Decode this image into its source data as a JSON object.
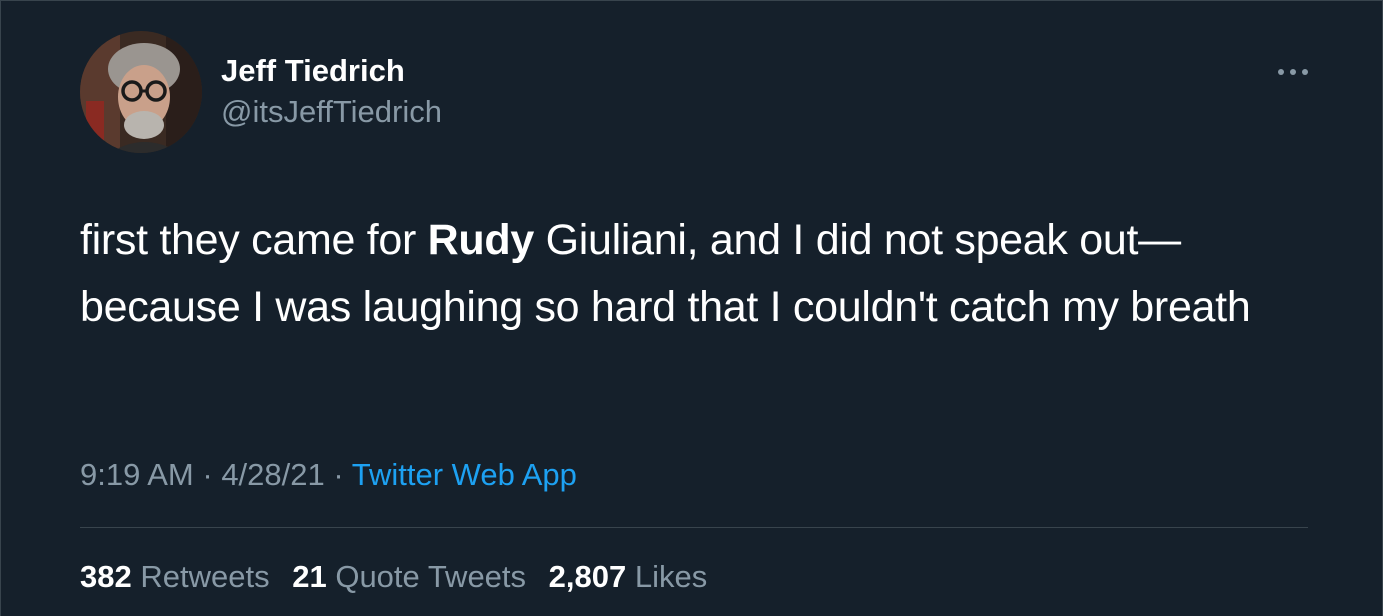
{
  "author": {
    "name": "Jeff Tiedrich",
    "handle": "@itsJeffTiedrich",
    "avatar_icon": "profile-photo"
  },
  "more_icon": "more-horizontal-icon",
  "tweet": {
    "text_part1": "first they came for ",
    "text_bold": "Rudy",
    "text_part2": " Giuliani, and I did not speak out—because I was laughing so hard that I couldn't catch my breath"
  },
  "meta": {
    "time": "9:19 AM",
    "sep1": " · ",
    "date": "4/28/21",
    "sep2": " · ",
    "source": "Twitter Web App"
  },
  "stats": {
    "retweets_count": "382",
    "retweets_label": "Retweets",
    "quotes_count": "21",
    "quotes_label": "Quote Tweets",
    "likes_count": "2,807",
    "likes_label": "Likes"
  },
  "colors": {
    "background": "#15202b",
    "text": "#ffffff",
    "secondary": "#8899a6",
    "link": "#1da1f2",
    "border": "#38444d"
  }
}
